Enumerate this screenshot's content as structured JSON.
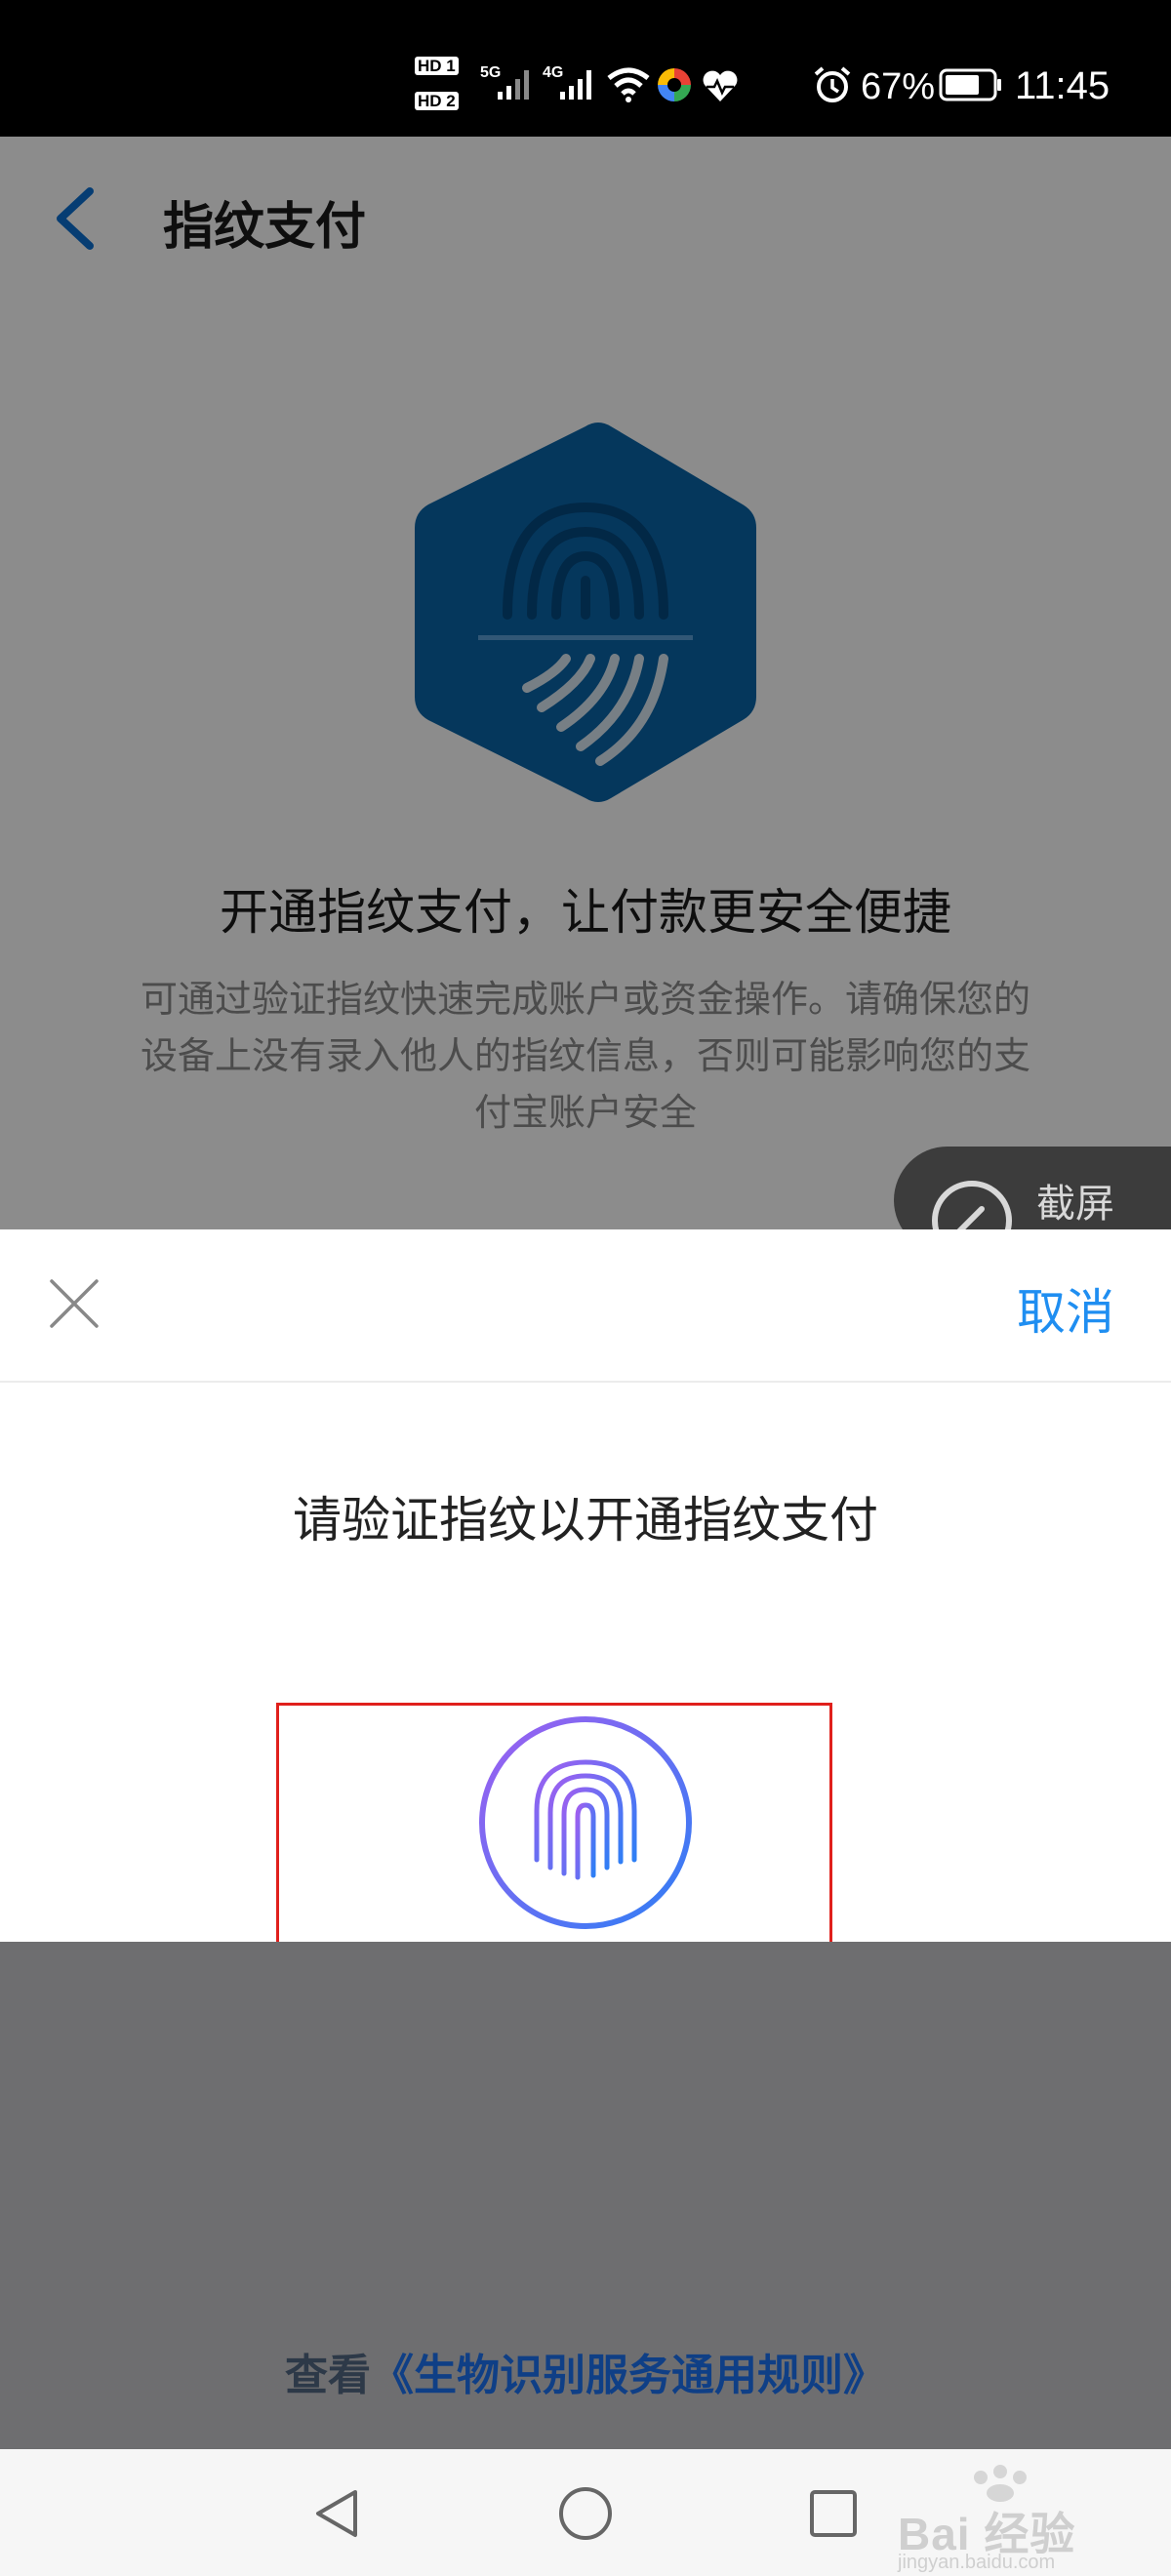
{
  "status_bar": {
    "hd1": "HD 1",
    "hd2": "HD 2",
    "net1": "5G",
    "net2": "4G",
    "battery_pct": "67%",
    "time": "11:45"
  },
  "page": {
    "title": "指纹支付",
    "headline": "开通指纹支付，让付款更安全便捷",
    "desc_line1": "可通过验证指纹快速完成账户或资金操作。请确保您的",
    "desc_line2": "设备上没有录入他人的指纹信息，否则可能影响您的支",
    "desc_line3": "付宝账户安全",
    "screenshot_label": "截屏"
  },
  "sheet": {
    "cancel_label": "取消",
    "prompt": "请验证指纹以开通指纹支付"
  },
  "footer": {
    "rules_prefix": "查看",
    "rules_link": "《生物识别服务通用规则》"
  },
  "watermark": {
    "logo": "Bai 经验",
    "url": "jingyan.baidu.com"
  },
  "colors": {
    "accent": "#1f8ef1",
    "hexagon": "#0a64a8",
    "highlight": "#e0201c"
  }
}
